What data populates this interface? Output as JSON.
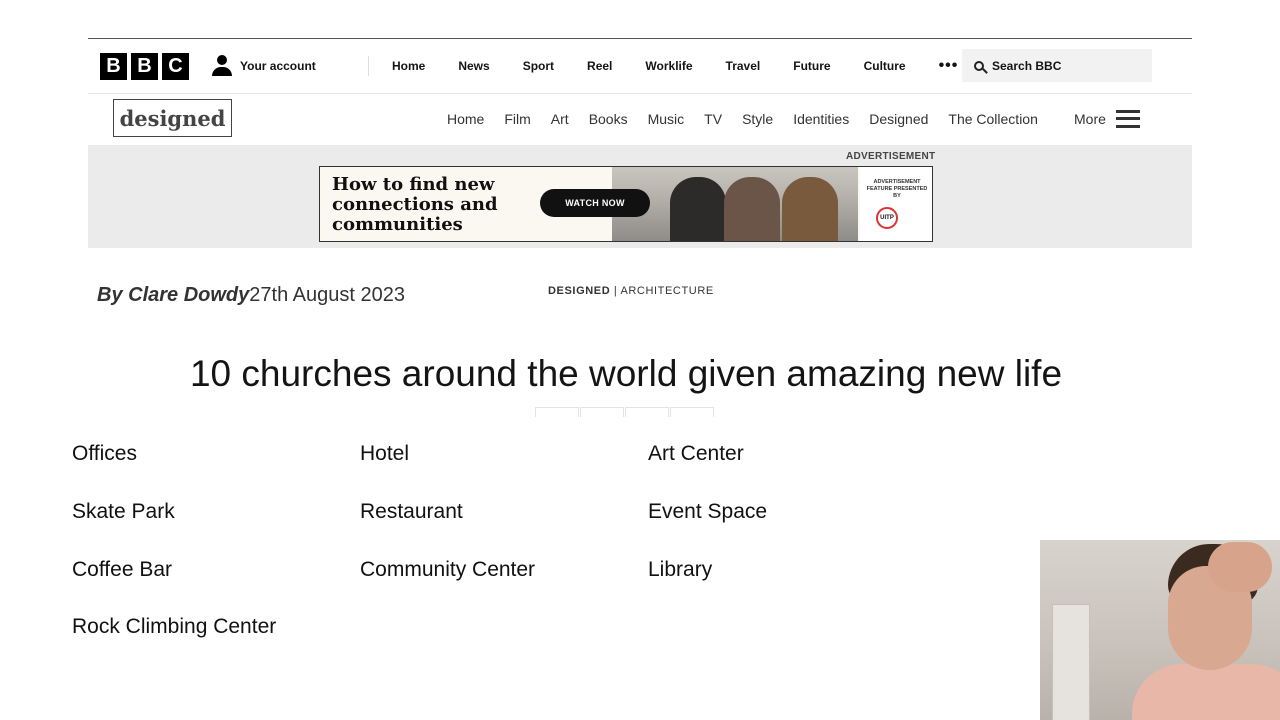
{
  "masthead": {
    "logo_letters": [
      "B",
      "B",
      "C"
    ],
    "account_label": "Your account",
    "nav": [
      "Home",
      "News",
      "Sport",
      "Reel",
      "Worklife",
      "Travel",
      "Future",
      "Culture"
    ],
    "more_dots": "•••",
    "search_placeholder": "Search BBC"
  },
  "subnav": {
    "logo_text": "designed",
    "links": [
      "Home",
      "Film",
      "Art",
      "Books",
      "Music",
      "TV",
      "Style",
      "Identities",
      "Designed",
      "The Collection"
    ],
    "more_label": "More"
  },
  "advert": {
    "label": "ADVERTISEMENT",
    "headline": "How to find new connections and communities",
    "cta": "WATCH NOW",
    "sponsor_text": "ADVERTISEMENT FEATURE PRESENTED BY",
    "sponsor_logo": "UITP"
  },
  "article": {
    "author": "By Clare Dowdy",
    "date": "27th August 2023",
    "section": "DESIGNED",
    "subsection": "ARCHITECTURE",
    "separator": " | ",
    "title": "10 churches around the world given amazing new life"
  },
  "uses_list": [
    [
      "Offices",
      "Hotel",
      "Art Center"
    ],
    [
      "Skate Park",
      "Restaurant",
      "Event Space"
    ],
    [
      "Coffee Bar",
      "Community Center",
      "Library"
    ],
    [
      "Rock Climbing Center"
    ]
  ],
  "colors": {
    "ad_band": "#ebebeb",
    "text": "#141414",
    "bbc_black": "#000000"
  }
}
